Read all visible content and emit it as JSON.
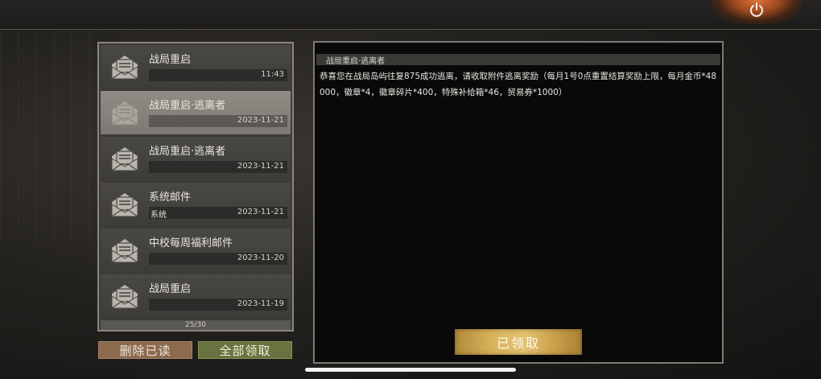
{
  "mail_list": {
    "items": [
      {
        "title": "战局重启",
        "sender": "",
        "date": "11:43",
        "selected": false
      },
      {
        "title": "战局重启·逃离者",
        "sender": "",
        "date": "2023-11-21",
        "selected": true
      },
      {
        "title": "战局重启·逃离者",
        "sender": "",
        "date": "2023-11-21",
        "selected": false
      },
      {
        "title": "系统邮件",
        "sender": "系统",
        "date": "2023-11-21",
        "selected": false
      },
      {
        "title": "中校每周福利邮件",
        "sender": "",
        "date": "2023-11-20",
        "selected": false
      },
      {
        "title": "战局重启",
        "sender": "",
        "date": "2023-11-19",
        "selected": false
      }
    ],
    "page_indicator": "25/30"
  },
  "buttons": {
    "delete_read": "删除已读",
    "claim_all": "全部领取",
    "claimed": "已领取"
  },
  "detail": {
    "title": "战局重启·逃离者",
    "body": "恭喜您在战局岛屿往复875成功逃离，请收取附件逃离奖励（每月1号0点重置结算奖励上限，每月金币*48000，徽章*4，徽章碎片*400，特殊补给箱*46，贸易券*1000）"
  },
  "icons": {
    "power": "power-icon",
    "mail": "mail-open-icon"
  }
}
